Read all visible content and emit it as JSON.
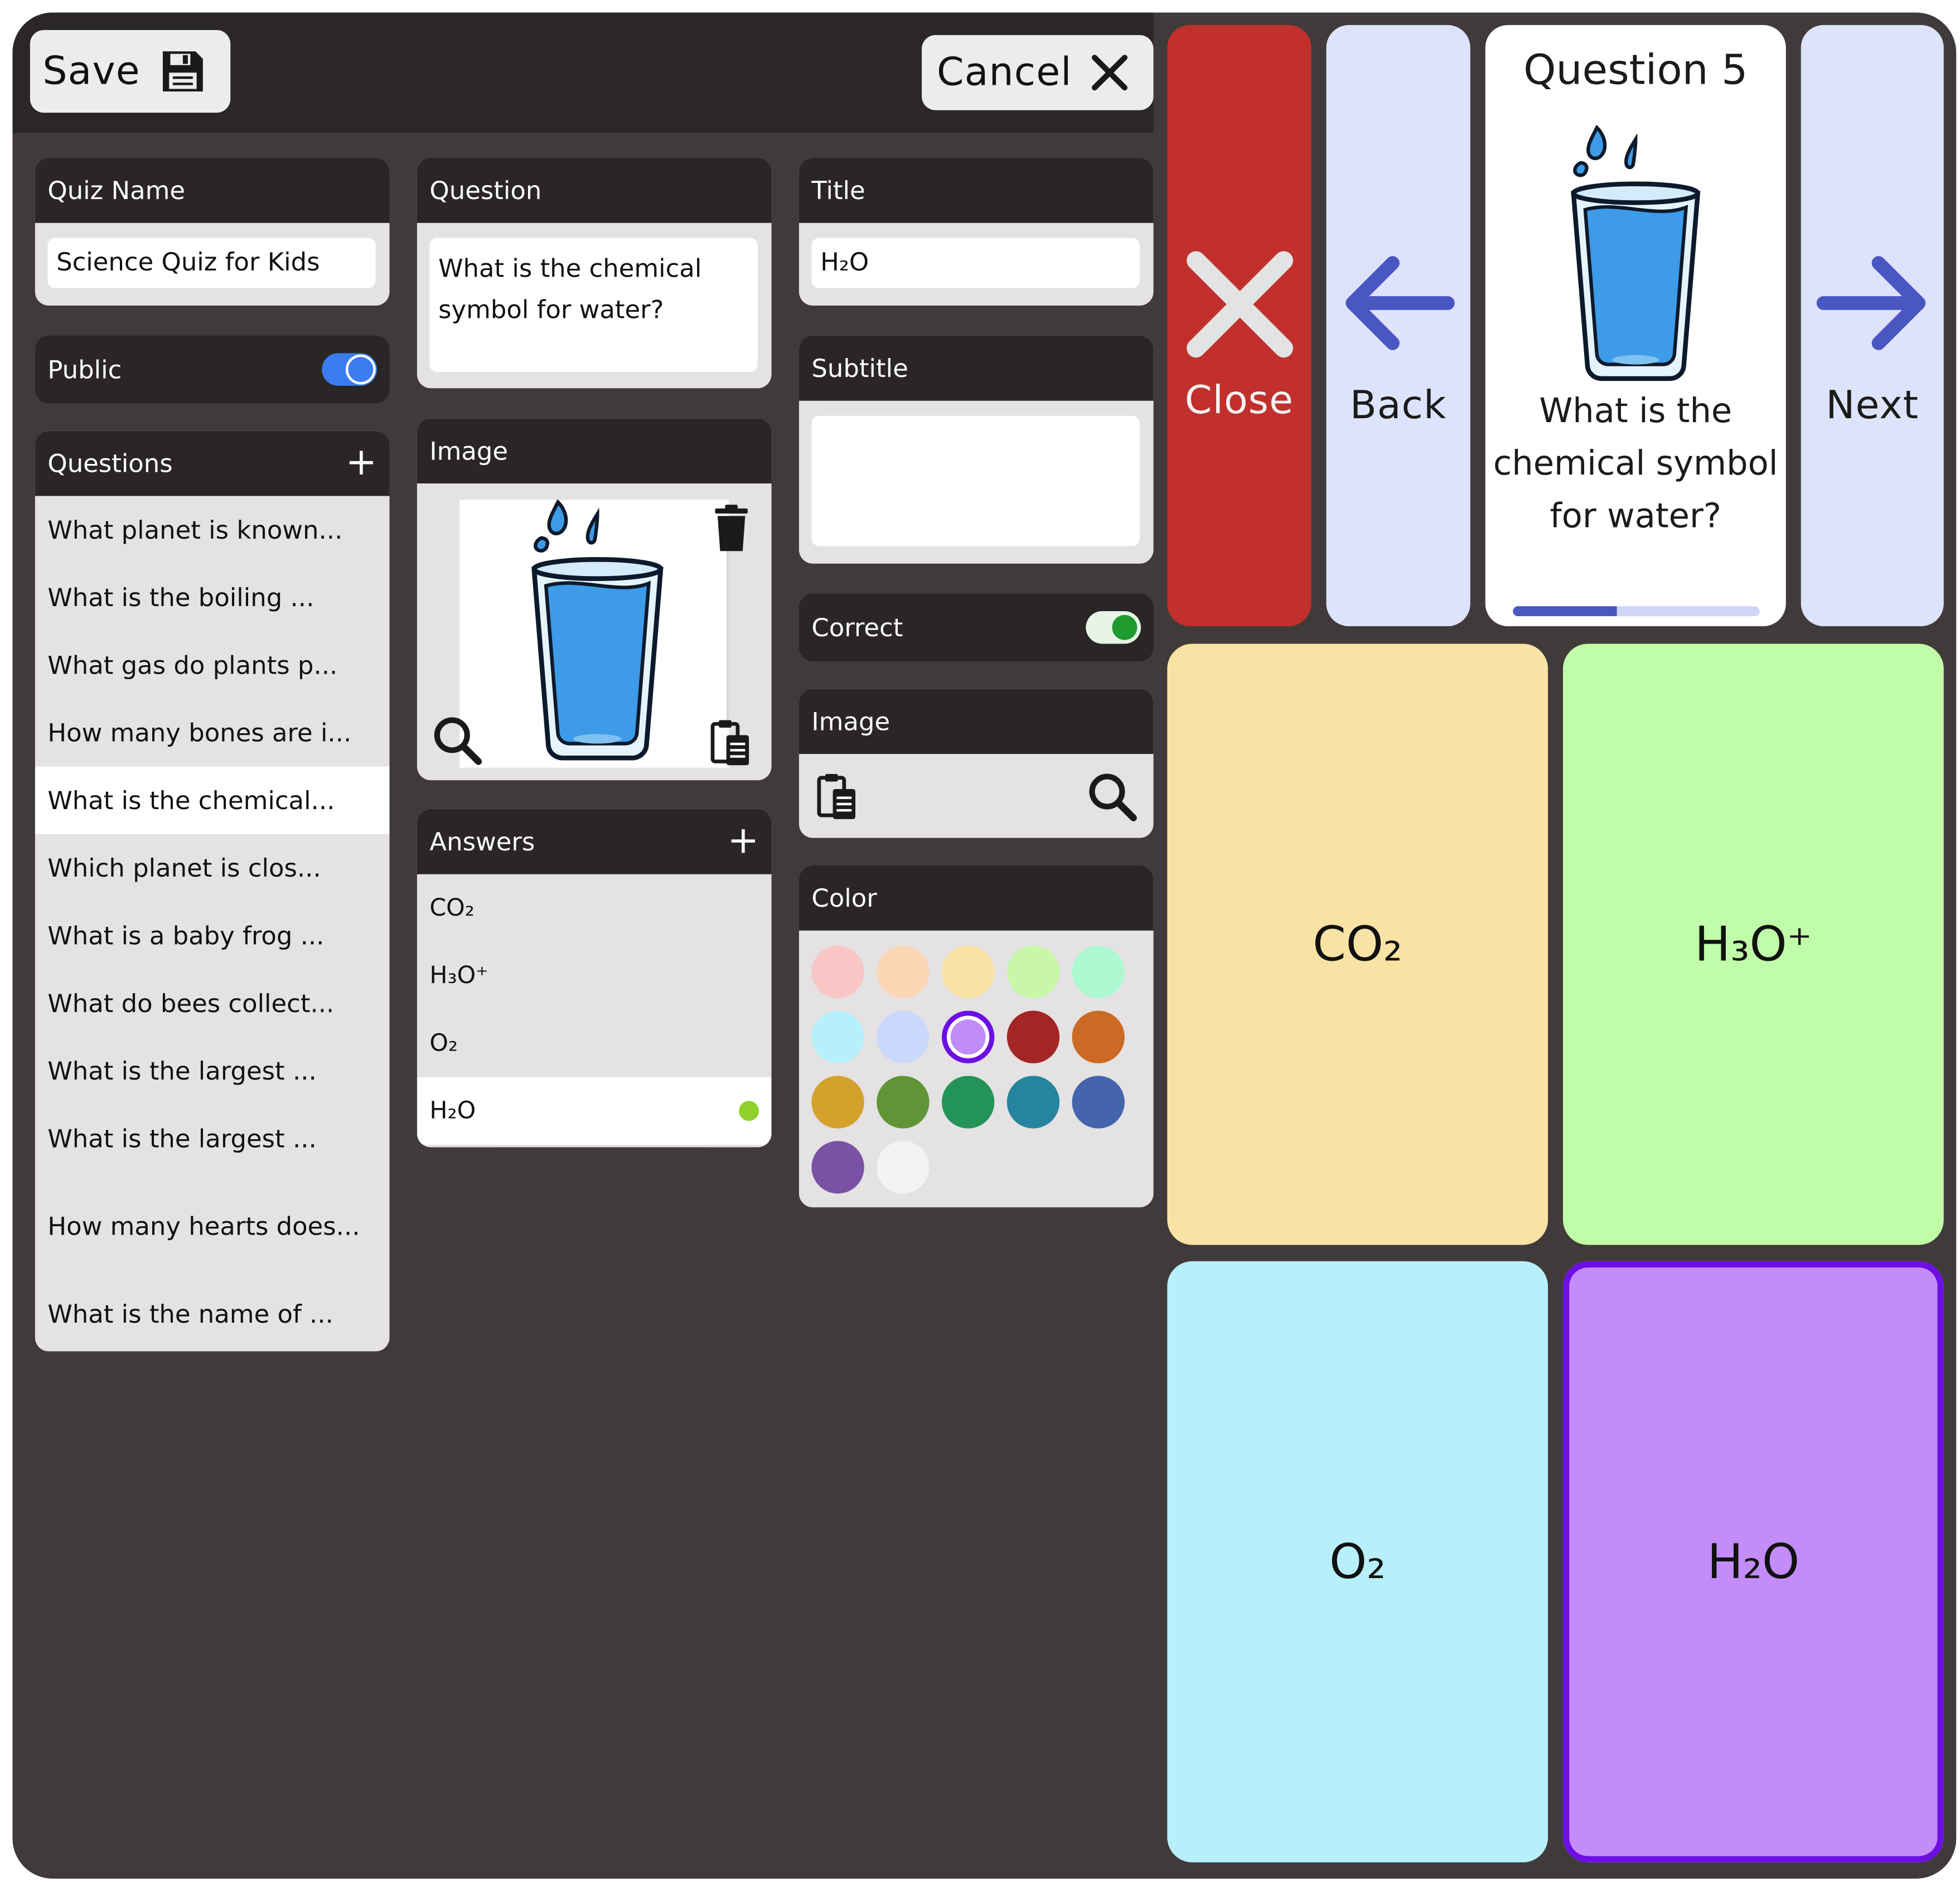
{
  "toolbar": {
    "save_label": "Save",
    "cancel_label": "Cancel"
  },
  "quiz_name": {
    "label": "Quiz Name",
    "value": "Science Quiz for Kids"
  },
  "public_toggle": {
    "label": "Public",
    "on": true,
    "color": "#3b7df0"
  },
  "questions": {
    "label": "Questions",
    "add_icon": "plus-icon",
    "items": [
      "What planet is known...",
      "What is the boiling ...",
      "What gas do plants p...",
      "How many bones are i...",
      "What is the chemical...",
      "Which planet is clos...",
      "What is a baby frog ...",
      "What do bees collect...",
      "What is the largest ...",
      "What is the largest ...",
      "How many hearts does...",
      "What is the name of ..."
    ],
    "active_index": 4
  },
  "question_field": {
    "label": "Question",
    "value": "What is the chemical symbol for water?"
  },
  "image_panel": {
    "label": "Image",
    "icons": [
      "trash-icon",
      "search-icon",
      "paste-icon"
    ]
  },
  "answers": {
    "label": "Answers",
    "add_icon": "plus-icon",
    "items": [
      "CO₂",
      "H₃O⁺",
      "O₂",
      "H₂O"
    ],
    "active_index": 3,
    "correct_dot_color": "#8fd12a"
  },
  "title_field": {
    "label": "Title",
    "value": "H₂O"
  },
  "subtitle_field": {
    "label": "Subtitle",
    "value": ""
  },
  "correct_toggle": {
    "label": "Correct",
    "on": true,
    "color": "#1f9a2e"
  },
  "answer_image": {
    "label": "Image",
    "icons": [
      "paste-icon",
      "search-icon"
    ]
  },
  "color_picker": {
    "label": "Color",
    "swatches": [
      "#f9c5c5",
      "#fbd6b4",
      "#f9e3a4",
      "#c8f7a8",
      "#adf7d1",
      "#b5f0fb",
      "#cad8fb",
      "#c28cf8",
      "#a32525",
      "#cb6a24",
      "#d4a12c",
      "#5f9537",
      "#239457",
      "#26849e",
      "#4464ad",
      "#7a51a4",
      "#f3f3f3"
    ],
    "selected_index": 7,
    "selected_ring": "#6d0fe4"
  },
  "nav": {
    "close_label": "Close",
    "back_label": "Back",
    "next_label": "Next",
    "close_color": "#c1302c",
    "nav_color": "#dde3fb",
    "arrow_color": "#4a56c2"
  },
  "preview": {
    "title": "Question 5",
    "text": "What is the chemical symbol for water?",
    "progress": 0.42
  },
  "answer_tiles": [
    {
      "text": "CO₂",
      "color": "#f9e3a4"
    },
    {
      "text": "H₃O⁺",
      "color": "#c1fda8"
    },
    {
      "text": "O₂",
      "color": "#b7effb"
    },
    {
      "text": "H₂O",
      "color": "#c38cf9"
    }
  ],
  "answer_tiles_selected_index": 3
}
